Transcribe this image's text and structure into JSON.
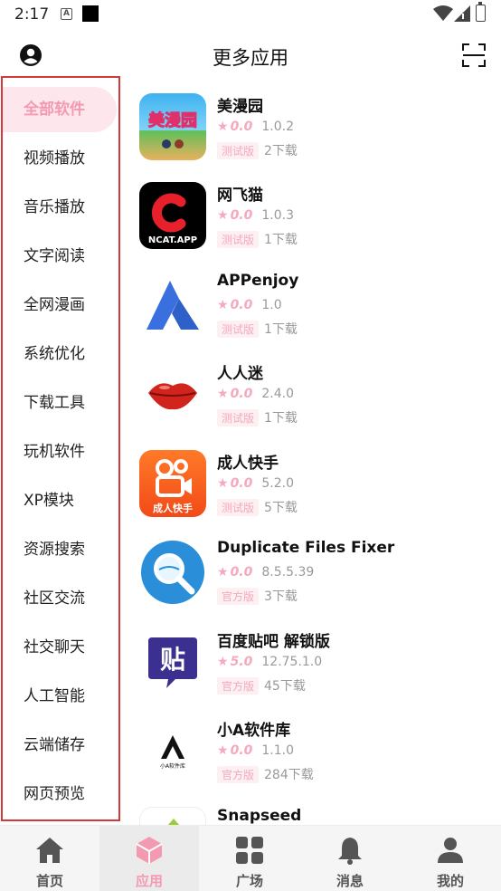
{
  "status_bar": {
    "time": "2:17",
    "notif_letter": "A"
  },
  "header": {
    "title": "更多应用",
    "user_icon": "user-icon",
    "scan_icon": "scan-icon"
  },
  "sidebar": {
    "items": [
      {
        "label": "全部软件",
        "active": true
      },
      {
        "label": "视频播放"
      },
      {
        "label": "音乐播放"
      },
      {
        "label": "文字阅读"
      },
      {
        "label": "全网漫画"
      },
      {
        "label": "系统优化"
      },
      {
        "label": "下载工具"
      },
      {
        "label": "玩机软件"
      },
      {
        "label": "XP模块"
      },
      {
        "label": "资源搜索"
      },
      {
        "label": "社区交流"
      },
      {
        "label": "社交聊天"
      },
      {
        "label": "人工智能"
      },
      {
        "label": "云端储存"
      },
      {
        "label": "网页预览"
      }
    ]
  },
  "apps": [
    {
      "name": "美漫园",
      "rating": "0.0",
      "version": "1.0.2",
      "badge": "测试版",
      "downloads": "2下载",
      "icon": "manhua-icon",
      "icon_text": "美漫园"
    },
    {
      "name": "网飞猫",
      "rating": "0.0",
      "version": "1.0.3",
      "badge": "测试版",
      "downloads": "1下载",
      "icon": "ncat-icon",
      "icon_text": "NCAT.APP"
    },
    {
      "name": "APPenjoy",
      "rating": "0.0",
      "version": "1.0",
      "badge": "测试版",
      "downloads": "1下载",
      "icon": "appenjoy-icon"
    },
    {
      "name": "人人迷",
      "rating": "0.0",
      "version": "2.4.0",
      "badge": "测试版",
      "downloads": "1下载",
      "icon": "lips-icon"
    },
    {
      "name": "成人快手",
      "rating": "0.0",
      "version": "5.2.0",
      "badge": "测试版",
      "downloads": "5下载",
      "icon": "kuaishou-icon",
      "icon_text": "成人快手"
    },
    {
      "name": "Duplicate Files Fixer",
      "rating": "0.0",
      "version": "8.5.5.39",
      "badge": "官方版",
      "downloads": "3下载",
      "icon": "magnifier-icon"
    },
    {
      "name": "百度贴吧 解锁版",
      "rating": "5.0",
      "version": "12.75.1.0",
      "badge": "官方版",
      "downloads": "45下载",
      "icon": "tieba-icon",
      "icon_text": "贴"
    },
    {
      "name": "小A软件库",
      "rating": "0.0",
      "version": "1.1.0",
      "badge": "官方版",
      "downloads": "284下载",
      "icon": "xiaoa-icon",
      "icon_text": "小A软件库"
    },
    {
      "name": "Snapseed",
      "icon": "snapseed-icon"
    }
  ],
  "bottom_nav": [
    {
      "label": "首页",
      "icon": "home-icon"
    },
    {
      "label": "应用",
      "icon": "cube-icon",
      "active": true
    },
    {
      "label": "广场",
      "icon": "grid-icon"
    },
    {
      "label": "消息",
      "icon": "bell-icon"
    },
    {
      "label": "我的",
      "icon": "person-icon"
    }
  ],
  "colors": {
    "accent": "#f39ab1",
    "sidebar_border": "#d23a3a",
    "active_bg": "#fde6ec"
  }
}
